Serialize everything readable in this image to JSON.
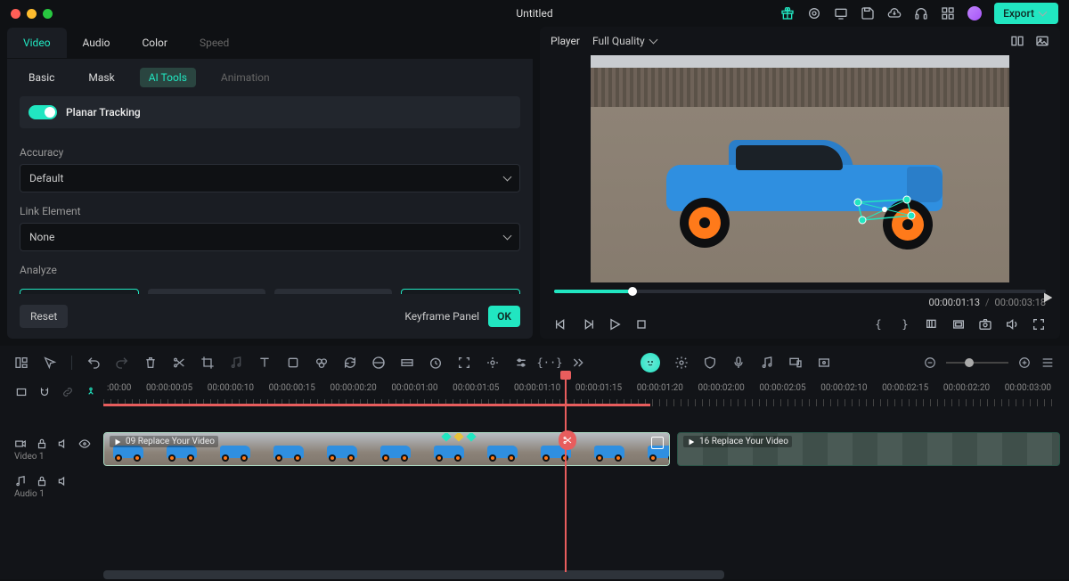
{
  "title": "Untitled",
  "export_label": "Export",
  "tabs": {
    "video": "Video",
    "audio": "Audio",
    "color": "Color",
    "speed": "Speed"
  },
  "subtabs": {
    "basic": "Basic",
    "mask": "Mask",
    "aitools": "AI Tools",
    "animation": "Animation"
  },
  "tracking": {
    "title": "Planar Tracking",
    "accuracy_label": "Accuracy",
    "accuracy_value": "Default",
    "link_label": "Link Element",
    "link_value": "None",
    "analyze_label": "Analyze"
  },
  "footer": {
    "reset": "Reset",
    "keyframe": "Keyframe Panel",
    "ok": "OK"
  },
  "player": {
    "label": "Player",
    "quality": "Full Quality",
    "current": "00:00:01:13",
    "total": "00:00:03:18"
  },
  "ruler": [
    ":00:00",
    "00:00:00:05",
    "00:00:00:10",
    "00:00:00:15",
    "00:00:00:20",
    "00:00:01:00",
    "00:00:01:05",
    "00:00:01:10",
    "00:00:01:15",
    "00:00:01:20",
    "00:00:02:00",
    "00:00:02:05",
    "00:00:02:10",
    "00:00:02:15",
    "00:00:02:20",
    "00:00:03:00"
  ],
  "tracks": {
    "video": "Video 1",
    "audio": "Audio 1"
  },
  "clips": {
    "clip1": "09 Replace Your Video",
    "clip2": "16 Replace Your Video"
  }
}
